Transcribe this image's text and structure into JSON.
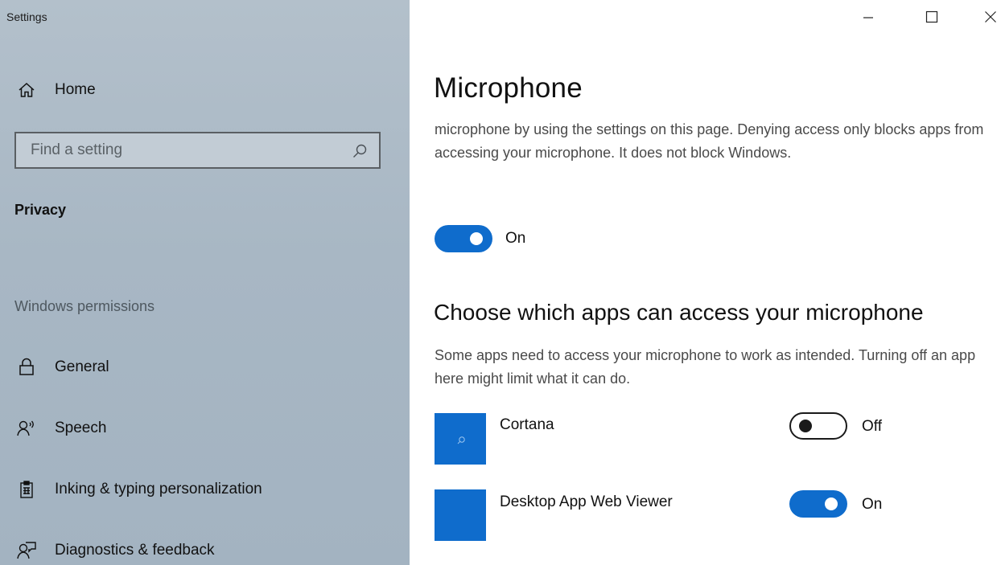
{
  "window": {
    "title": "Settings",
    "controls": [
      "minimize",
      "maximize",
      "close"
    ]
  },
  "sidebar": {
    "home_label": "Home",
    "search_placeholder": "Find a setting",
    "section_label": "Privacy",
    "group_label": "Windows permissions",
    "items": [
      {
        "label": "General",
        "icon": "lock-icon"
      },
      {
        "label": "Speech",
        "icon": "speech-icon"
      },
      {
        "label": "Inking & typing personalization",
        "icon": "clipboard-icon"
      },
      {
        "label": "Diagnostics & feedback",
        "icon": "feedback-icon"
      }
    ]
  },
  "main": {
    "title": "Microphone",
    "intro": "microphone by using the settings on this page. Denying access only blocks apps from accessing your microphone. It does not block Windows.",
    "master_toggle": {
      "state": "On",
      "on": true
    },
    "apps_heading": "Choose which apps can access your microphone",
    "apps_description": "Some apps need to access your microphone to work as intended. Turning off an app here might limit what it can do.",
    "apps": [
      {
        "name": "Cortana",
        "state": "Off",
        "on": false
      },
      {
        "name": "Desktop App Web Viewer",
        "state": "On",
        "on": true
      }
    ]
  },
  "colors": {
    "accent": "#0f6ccc",
    "sidebar_bg": "#a9b8c5"
  }
}
